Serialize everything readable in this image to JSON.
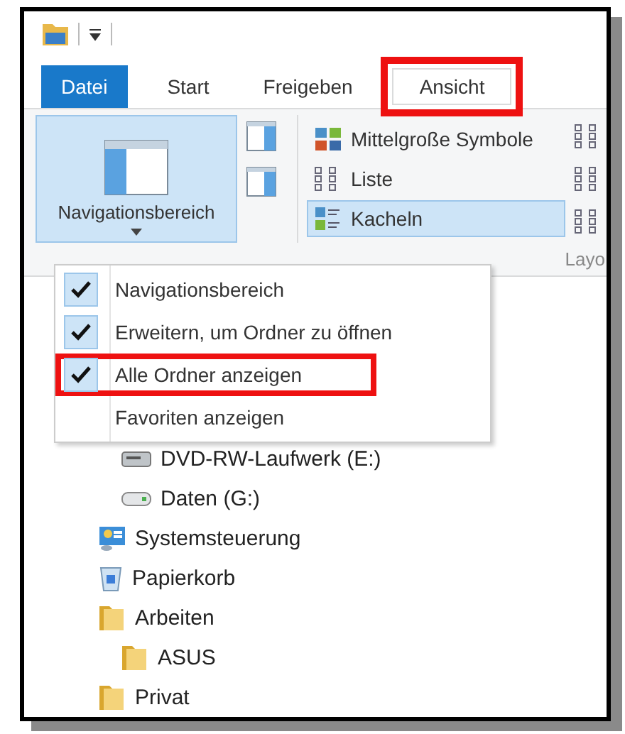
{
  "tabs": [
    {
      "label": "Datei",
      "kind": "file",
      "selected": false,
      "highlighted": false
    },
    {
      "label": "Start",
      "kind": "tab",
      "selected": false,
      "highlighted": false
    },
    {
      "label": "Freigeben",
      "kind": "tab",
      "selected": false,
      "highlighted": false
    },
    {
      "label": "Ansicht",
      "kind": "tab",
      "selected": true,
      "highlighted": true
    }
  ],
  "ribbon": {
    "pane_button": {
      "label": "Navigationsbereich",
      "expanded": true
    },
    "layout_items": [
      {
        "label": "Mittelgroße Symbole",
        "kind": "medium",
        "selected": false
      },
      {
        "label": "Liste",
        "kind": "list",
        "selected": false
      },
      {
        "label": "Kacheln",
        "kind": "tiles",
        "selected": true
      }
    ],
    "group_label": "Layo"
  },
  "menu": [
    {
      "label": "Navigationsbereich",
      "checked": true,
      "highlighted": false
    },
    {
      "label": "Erweitern, um Ordner zu öffnen",
      "checked": true,
      "highlighted": false
    },
    {
      "label": "Alle Ordner anzeigen",
      "checked": true,
      "highlighted": true
    },
    {
      "label": "Favoriten anzeigen",
      "checked": false,
      "highlighted": false
    }
  ],
  "tree_top_children": [
    {
      "label": "DVD-RW-Laufwerk (E:)",
      "kind": "dvd"
    },
    {
      "label": "Daten (G:)",
      "kind": "drive"
    }
  ],
  "tree": [
    {
      "label": "Systemsteuerung",
      "kind": "control"
    },
    {
      "label": "Papierkorb",
      "kind": "bin"
    },
    {
      "label": "Arbeiten",
      "kind": "folder",
      "children": [
        {
          "label": "ASUS",
          "kind": "folder"
        }
      ]
    },
    {
      "label": "Privat",
      "kind": "folder"
    }
  ]
}
